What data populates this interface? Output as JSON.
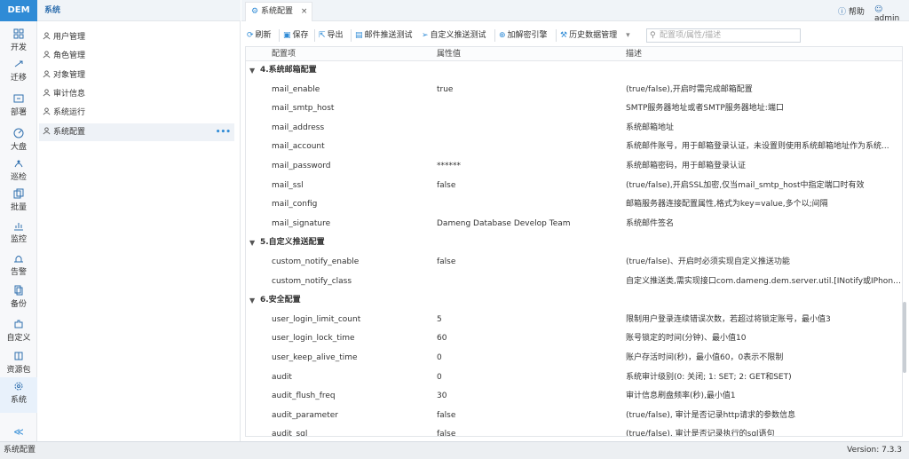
{
  "app": {
    "logo": "DEM"
  },
  "rail": [
    {
      "label": "开发",
      "icon": "grid-icon"
    },
    {
      "label": "迁移",
      "icon": "transfer-icon"
    },
    {
      "label": "部署",
      "icon": "deploy-icon"
    },
    {
      "label": "大盘",
      "icon": "dashboard-icon"
    },
    {
      "label": "巡检",
      "icon": "inspect-icon"
    },
    {
      "label": "批量",
      "icon": "batch-icon"
    },
    {
      "label": "监控",
      "icon": "monitor-icon"
    },
    {
      "label": "告警",
      "icon": "alarm-icon"
    },
    {
      "label": "备份",
      "icon": "backup-icon"
    },
    {
      "label": "自定义",
      "icon": "puzzle-icon"
    },
    {
      "label": "资源包",
      "icon": "package-icon"
    },
    {
      "label": "系统",
      "icon": "gear-icon"
    }
  ],
  "rail_collapse": "≪",
  "sidebar": {
    "title": "系统",
    "items": [
      {
        "label": "用户管理",
        "icon": "user-icon"
      },
      {
        "label": "角色管理",
        "icon": "role-icon"
      },
      {
        "label": "对象管理",
        "icon": "object-icon"
      },
      {
        "label": "审计信息",
        "icon": "audit-icon"
      },
      {
        "label": "系统运行",
        "icon": "run-icon"
      },
      {
        "label": "系统配置",
        "icon": "settings-icon"
      }
    ],
    "more": "•••"
  },
  "tab": {
    "label": "系统配置",
    "close": "×"
  },
  "header": {
    "help": "帮助",
    "user": "admin"
  },
  "toolbar": {
    "refresh": "刷新",
    "save": "保存",
    "export": "导出",
    "mail_test": "邮件推送测试",
    "custom_test": "自定义推送测试",
    "add_cipher": "加解密引擎",
    "history": "历史数据管理",
    "search_placeholder": "配置项/属性/描述"
  },
  "grid": {
    "columns": [
      "配置项",
      "属性值",
      "描述"
    ],
    "groups": [
      {
        "title": "4.系统邮箱配置",
        "rows": [
          {
            "key": "mail_enable",
            "value": "true",
            "desc": "(true/false),开启时需完成邮箱配置"
          },
          {
            "key": "mail_smtp_host",
            "value": "",
            "desc": "SMTP服务器地址或者SMTP服务器地址:端口"
          },
          {
            "key": "mail_address",
            "value": "",
            "desc": "系统邮箱地址"
          },
          {
            "key": "mail_account",
            "value": "",
            "desc": "系统邮件账号，用于邮箱登录认证，未设置则使用系统邮箱地址作为系统..."
          },
          {
            "key": "mail_password",
            "value": "******",
            "desc": "系统邮箱密码，用于邮箱登录认证"
          },
          {
            "key": "mail_ssl",
            "value": "false",
            "desc": "(true/false),开启SSL加密,仅当mail_smtp_host中指定端口时有效"
          },
          {
            "key": "mail_config",
            "value": "",
            "desc": "邮箱服务器连接配置属性,格式为key=value,多个以;间隔"
          },
          {
            "key": "mail_signature",
            "value": "Dameng Database Develop Team",
            "desc": "系统邮件签名"
          }
        ]
      },
      {
        "title": "5.自定义推送配置",
        "rows": [
          {
            "key": "custom_notify_enable",
            "value": "false",
            "desc": "(true/false)、开启时必须实现自定义推送功能"
          },
          {
            "key": "custom_notify_class",
            "value": "",
            "desc": "自定义推送类,需实现接口com.dameng.dem.server.util.[INotify或IPhoneNo..."
          }
        ]
      },
      {
        "title": "6.安全配置",
        "rows": [
          {
            "key": "user_login_limit_count",
            "value": "5",
            "desc": "限制用户登录连续错误次数，若超过将锁定账号，最小值3"
          },
          {
            "key": "user_login_lock_time",
            "value": "60",
            "desc": "账号锁定的时间(分钟)、最小值10"
          },
          {
            "key": "user_keep_alive_time",
            "value": "0",
            "desc": "账户存活时间(秒)，最小值60，0表示不限制"
          },
          {
            "key": "audit",
            "value": "0",
            "desc": "系统审计级别(0: 关闭; 1: SET; 2: GET和SET)"
          },
          {
            "key": "audit_flush_freq",
            "value": "30",
            "desc": "审计信息刷盘频率(秒),最小值1"
          },
          {
            "key": "audit_parameter",
            "value": "false",
            "desc": "(true/false), 审计是否记录http请求的参数信息"
          },
          {
            "key": "audit_sql",
            "value": "false",
            "desc": "(true/false), 审计是否记录执行的sql语句"
          }
        ]
      }
    ]
  },
  "status": {
    "left": "系统配置",
    "right": "Version: 7.3.3"
  }
}
